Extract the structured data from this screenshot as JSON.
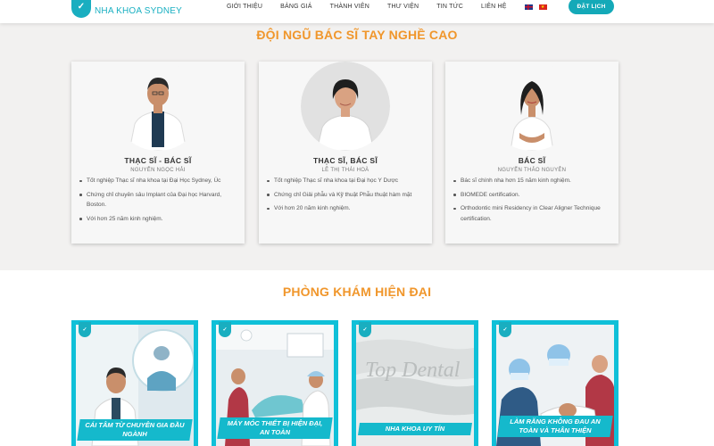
{
  "brand": {
    "mark": "✓",
    "name": "NHA KHOA SYDNEY"
  },
  "nav": {
    "items": [
      "GIỚI THIỆU",
      "BẢNG GIÁ",
      "THÀNH VIÊN",
      "THƯ VIỆN",
      "TIN TỨC",
      "LIÊN HỆ"
    ],
    "book_label": "ĐẶT LỊCH"
  },
  "doctors": {
    "title": "ĐỘI NGŨ BÁC SĨ TAY NGHỀ CAO",
    "cards": [
      {
        "role": "THẠC SĨ - BÁC SĨ",
        "name": "NGUYỄN NGỌC HẢI",
        "items": [
          "Tốt nghiệp Thạc sĩ nha khoa tại Đại Học Sydney, Úc",
          "Chứng chỉ chuyên sâu Implant của Đại học Harvard, Boston.",
          "Với hơn 25 năm kinh nghiệm."
        ]
      },
      {
        "role": "THẠC SĨ, BÁC SĨ",
        "name": "LÊ THỊ THÁI HOÀ",
        "items": [
          "Tốt nghiệp Thạc sĩ nha khoa tại Đại học Y Dược",
          "Chứng chỉ Giải phẫu và Kỹ thuật Phẫu thuật hàm mặt",
          "Với hơn 20 năm kinh nghiệm."
        ]
      },
      {
        "role": "BÁC SĨ",
        "name": "NGUYỄN THẢO NGUYÊN",
        "items": [
          "Bác sĩ chính nha hơn 15 năm kinh nghiệm.",
          "BIOMEDE certification.",
          "Orthodontic mini Residency in Clear Aligner Technique certification."
        ]
      }
    ]
  },
  "clinic": {
    "title": "PHÒNG KHÁM HIỆN ĐẠI",
    "tiles": [
      {
        "caption": "CÁI TÂM TỪ CHUYÊN GIA ĐẦU NGÀNH"
      },
      {
        "caption": "MÁY MÓC THIẾT BỊ HIỆN ĐẠI, AN TOÀN"
      },
      {
        "caption": "NHA KHOA UY TÍN",
        "sign": "Top Dental"
      },
      {
        "caption": "LÀM RĂNG KHÔNG ĐAU AN TOÀN VÀ THÂN THIỆN"
      }
    ]
  },
  "colors": {
    "accent": "#14a9b8",
    "title": "#f0962b",
    "tile_frame": "#0fc0d8"
  },
  "icons": [
    "tooth-logo-icon",
    "flag-en-icon",
    "flag-vn-icon"
  ]
}
